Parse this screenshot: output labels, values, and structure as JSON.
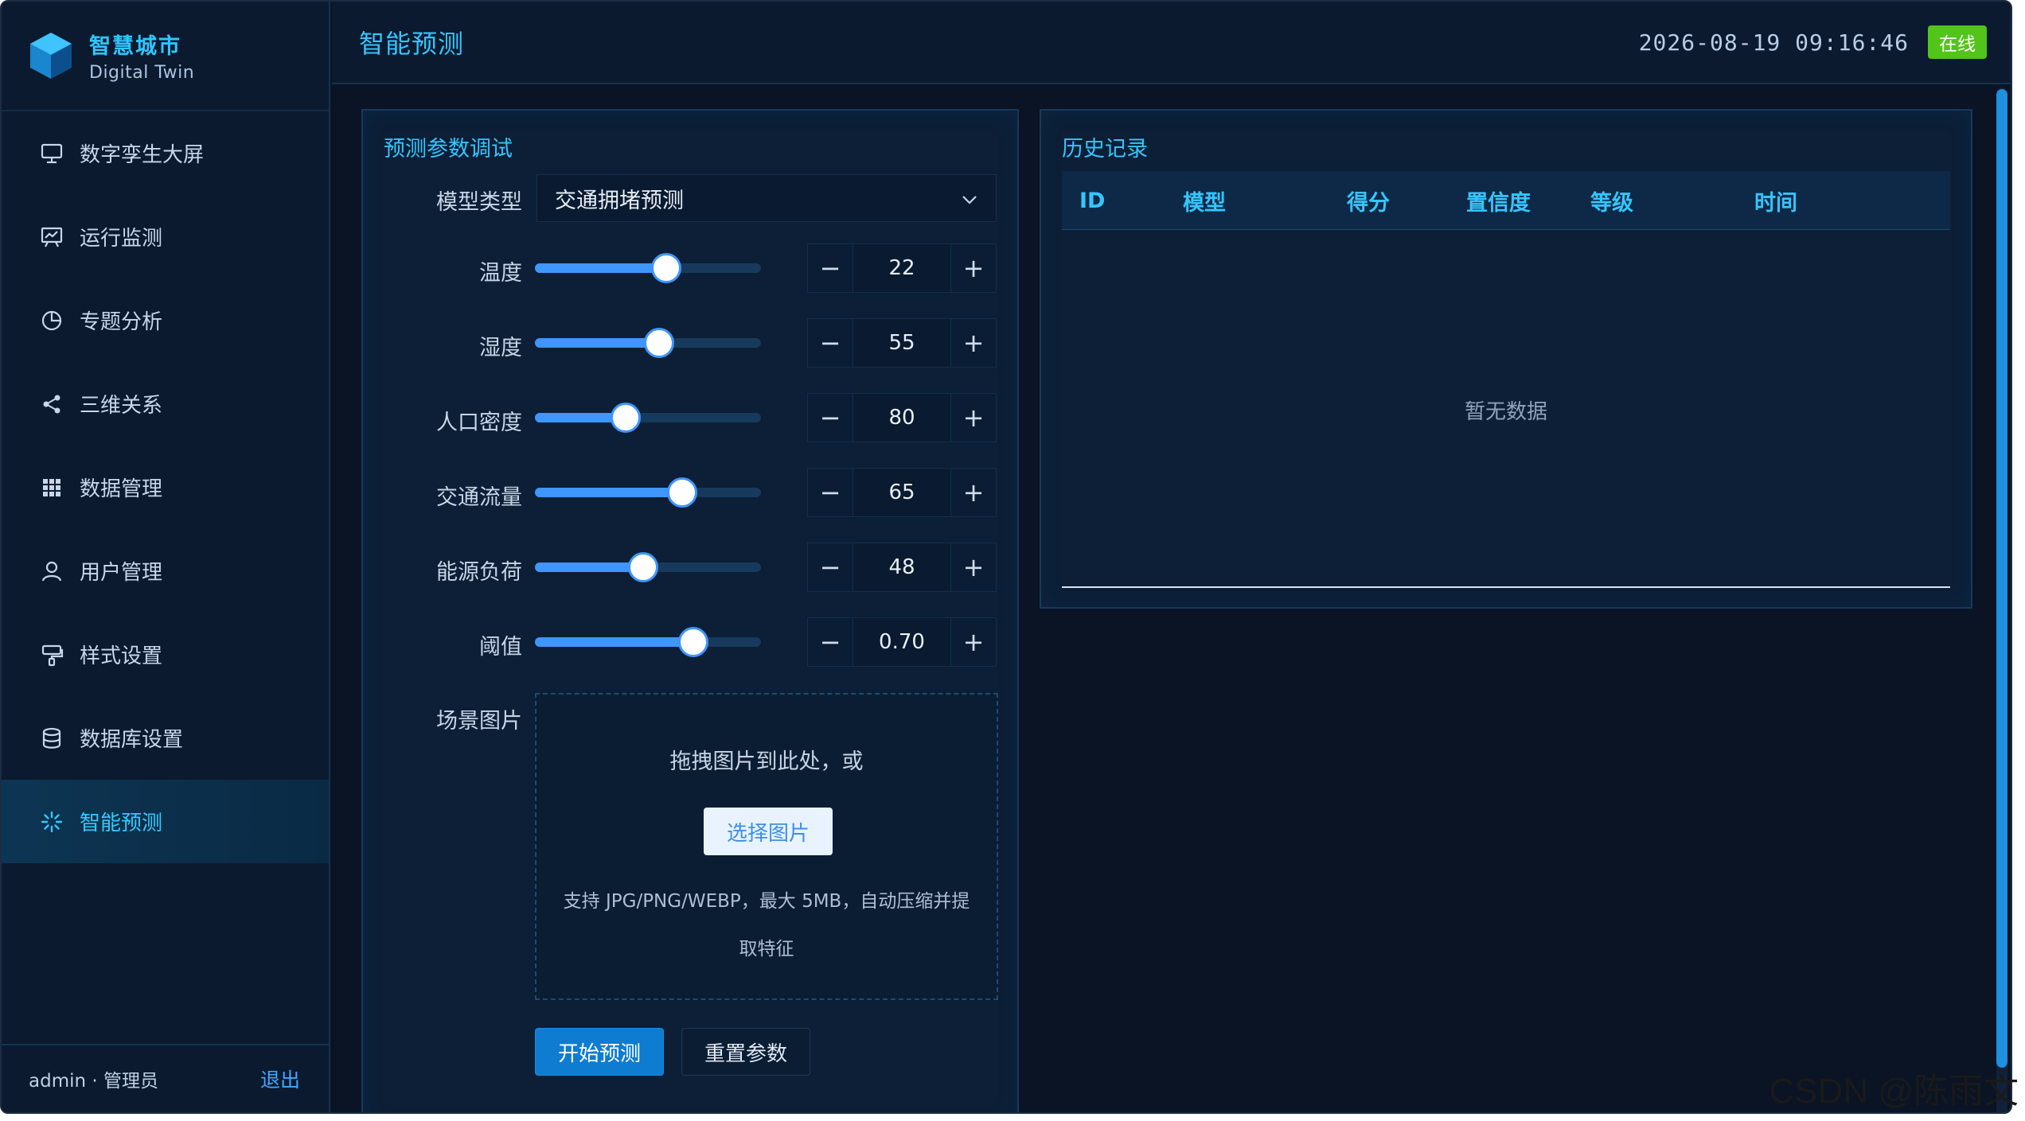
{
  "brand": {
    "title": "智慧城市",
    "subtitle": "Digital Twin"
  },
  "sidebar": {
    "items": [
      {
        "label": "数字孪生大屏",
        "icon": "monitor-icon"
      },
      {
        "label": "运行监测",
        "icon": "chart-board-icon"
      },
      {
        "label": "专题分析",
        "icon": "pie-chart-icon"
      },
      {
        "label": "三维关系",
        "icon": "share-icon"
      },
      {
        "label": "数据管理",
        "icon": "grid-icon"
      },
      {
        "label": "用户管理",
        "icon": "user-icon"
      },
      {
        "label": "样式设置",
        "icon": "brush-icon"
      },
      {
        "label": "数据库设置",
        "icon": "database-icon"
      },
      {
        "label": "智能预测",
        "icon": "loading-icon",
        "active": true
      }
    ],
    "footer": {
      "user": "admin · 管理员",
      "logout": "退出"
    }
  },
  "header": {
    "title": "智能预测",
    "datetime": "2026-08-19 09:16:46",
    "status": "在线"
  },
  "params": {
    "title": "预测参数调试",
    "model_label": "模型类型",
    "model_value": "交通拥堵预测",
    "sliders": [
      {
        "label": "温度",
        "value": "22",
        "fraction": 0.58
      },
      {
        "label": "湿度",
        "value": "55",
        "fraction": 0.55
      },
      {
        "label": "人口密度",
        "value": "80",
        "fraction": 0.4
      },
      {
        "label": "交通流量",
        "value": "65",
        "fraction": 0.65
      },
      {
        "label": "能源负荷",
        "value": "48",
        "fraction": 0.48
      },
      {
        "label": "阈值",
        "value": "0.70",
        "fraction": 0.7
      }
    ],
    "image_label": "场景图片",
    "upload_hint": "拖拽图片到此处，或",
    "upload_button": "选择图片",
    "upload_desc": "支持 JPG/PNG/WEBP，最大 5MB，自动压缩并提取特征",
    "start_button": "开始预测",
    "reset_button": "重置参数"
  },
  "history": {
    "title": "历史记录",
    "columns": [
      "ID",
      "模型",
      "得分",
      "置信度",
      "等级",
      "时间"
    ],
    "empty_text": "暂无数据"
  },
  "watermark": "CSDN @陈雨文",
  "colors": {
    "accent": "#35c5ff",
    "primary": "#0e7cd0",
    "online": "#52c41a",
    "bg": "#0a1424"
  }
}
